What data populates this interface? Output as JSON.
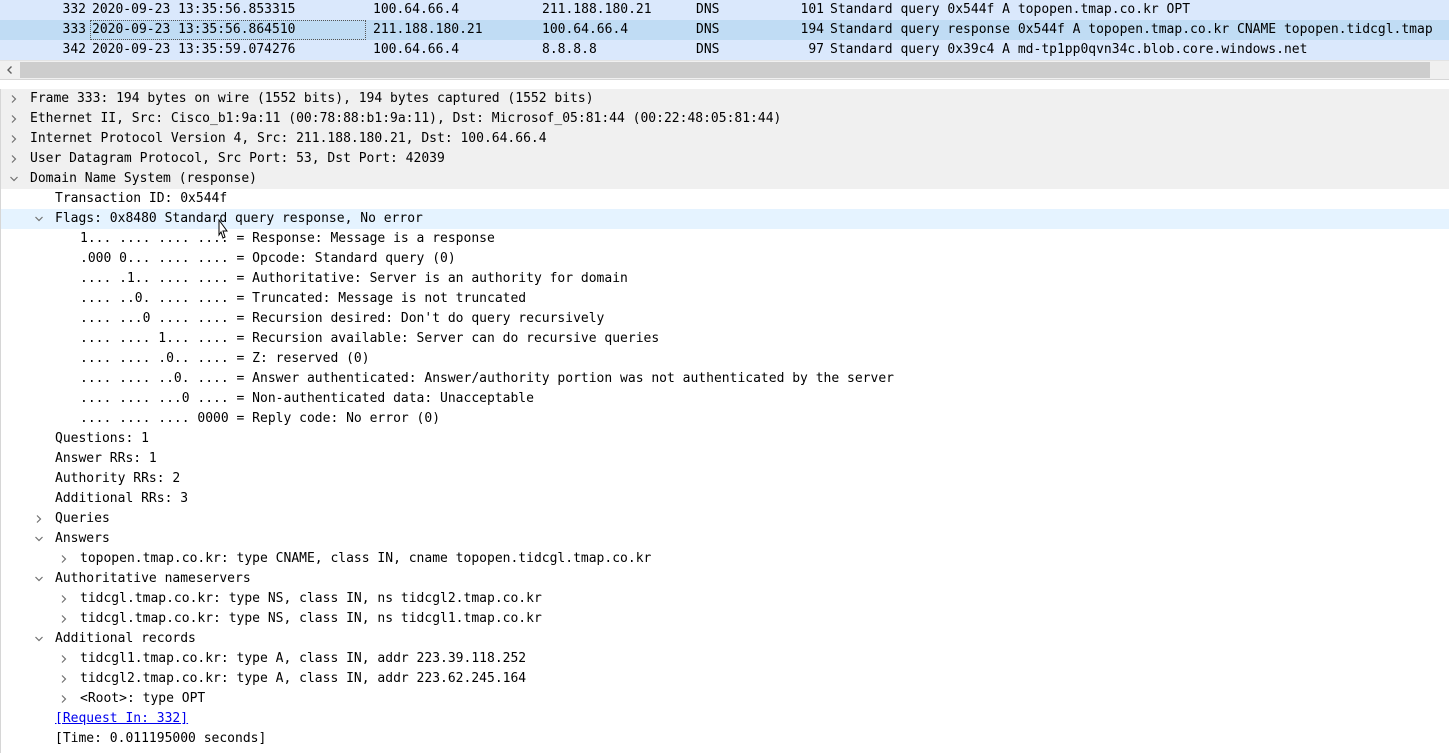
{
  "packets": [
    {
      "no": "332",
      "time": "2020-09-23 13:35:56.853315",
      "source": "100.64.66.4",
      "destination": "211.188.180.21",
      "protocol": "DNS",
      "length": "101",
      "info": "Standard query 0x544f A topopen.tmap.co.kr OPT"
    },
    {
      "no": "333",
      "time": "2020-09-23 13:35:56.864510",
      "source": "211.188.180.21",
      "destination": "100.64.66.4",
      "protocol": "DNS",
      "length": "194",
      "info": "Standard query response 0x544f A topopen.tmap.co.kr CNAME topopen.tidcgl.tmap"
    },
    {
      "no": "342",
      "time": "2020-09-23 13:35:59.074276",
      "source": "100.64.66.4",
      "destination": "8.8.8.8",
      "protocol": "DNS",
      "length": "97",
      "info": "Standard query 0x39c4 A md-tp1pp0qvn34c.blob.core.windows.net"
    }
  ],
  "details": {
    "frame": "Frame 333: 194 bytes on wire (1552 bits), 194 bytes captured (1552 bits)",
    "ethernet": "Ethernet II, Src: Cisco_b1:9a:11 (00:78:88:b1:9a:11), Dst: Microsof_05:81:44 (00:22:48:05:81:44)",
    "ip": "Internet Protocol Version 4, Src: 211.188.180.21, Dst: 100.64.66.4",
    "udp": "User Datagram Protocol, Src Port: 53, Dst Port: 42039",
    "dns": "Domain Name System (response)",
    "transaction_id": "Transaction ID: 0x544f",
    "flags": "Flags: 0x8480 Standard query response, No error",
    "flag_bits": [
      "1... .... .... .... = Response: Message is a response",
      ".000 0... .... .... = Opcode: Standard query (0)",
      ".... .1.. .... .... = Authoritative: Server is an authority for domain",
      ".... ..0. .... .... = Truncated: Message is not truncated",
      ".... ...0 .... .... = Recursion desired: Don't do query recursively",
      ".... .... 1... .... = Recursion available: Server can do recursive queries",
      ".... .... .0.. .... = Z: reserved (0)",
      ".... .... ..0. .... = Answer authenticated: Answer/authority portion was not authenticated by the server",
      ".... .... ...0 .... = Non-authenticated data: Unacceptable",
      ".... .... .... 0000 = Reply code: No error (0)"
    ],
    "questions": "Questions: 1",
    "answer_rrs": "Answer RRs: 1",
    "authority_rrs": "Authority RRs: 2",
    "additional_rrs": "Additional RRs: 3",
    "queries": "Queries",
    "answers": "Answers",
    "answer_items": [
      "topopen.tmap.co.kr: type CNAME, class IN, cname topopen.tidcgl.tmap.co.kr"
    ],
    "authoritative_ns": "Authoritative nameservers",
    "ns_items": [
      "tidcgl.tmap.co.kr: type NS, class IN, ns tidcgl2.tmap.co.kr",
      "tidcgl.tmap.co.kr: type NS, class IN, ns tidcgl1.tmap.co.kr"
    ],
    "additional_records": "Additional records",
    "additional_items": [
      "tidcgl1.tmap.co.kr: type A, class IN, addr 223.39.118.252",
      "tidcgl2.tmap.co.kr: type A, class IN, addr 223.62.245.164",
      "<Root>: type OPT"
    ],
    "request_in": "[Request In: 332]",
    "time": "[Time: 0.011195000 seconds]"
  },
  "icons": {
    "collapsed": "chevron-right-icon",
    "expanded": "chevron-down-icon",
    "scroll_left": "arrow-left-icon"
  },
  "colors": {
    "row_dns": "#dae8fc",
    "row_selected": "#c0dcf4",
    "tree_top_level": "#f0f0f0",
    "tree_hover": "#e5f3ff",
    "link": "#0000ee"
  }
}
